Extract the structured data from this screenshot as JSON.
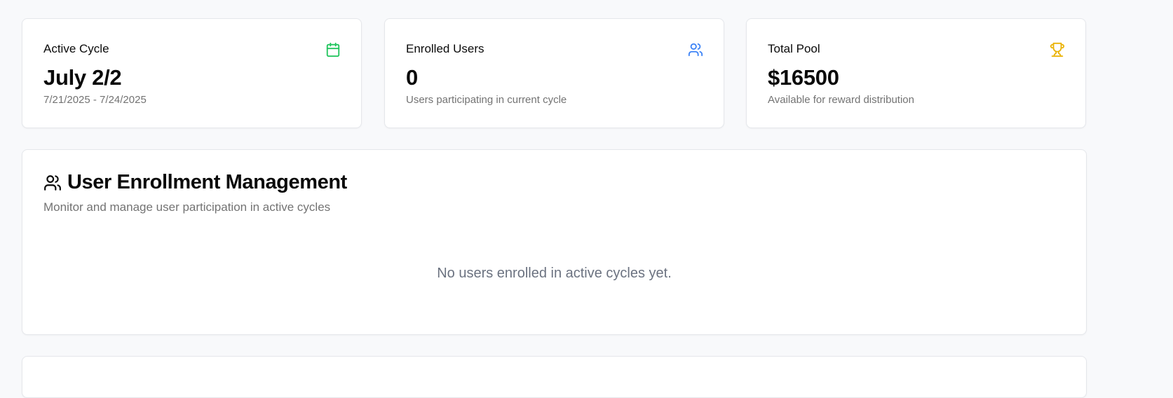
{
  "stats": {
    "active_cycle": {
      "title": "Active Cycle",
      "value": "July 2/2",
      "subtitle": "7/21/2025 - 7/24/2025",
      "icon": "calendar-icon",
      "icon_color": "#22c55e"
    },
    "enrolled_users": {
      "title": "Enrolled Users",
      "value": "0",
      "subtitle": "Users participating in current cycle",
      "icon": "users-icon",
      "icon_color": "#3b82f6"
    },
    "total_pool": {
      "title": "Total Pool",
      "value": "$16500",
      "subtitle": "Available for reward distribution",
      "icon": "trophy-icon",
      "icon_color": "#eab308"
    }
  },
  "enrollment": {
    "title": "User Enrollment Management",
    "description": "Monitor and manage user participation in active cycles",
    "empty_message": "No users enrolled in active cycles yet.",
    "icon": "users-icon"
  }
}
